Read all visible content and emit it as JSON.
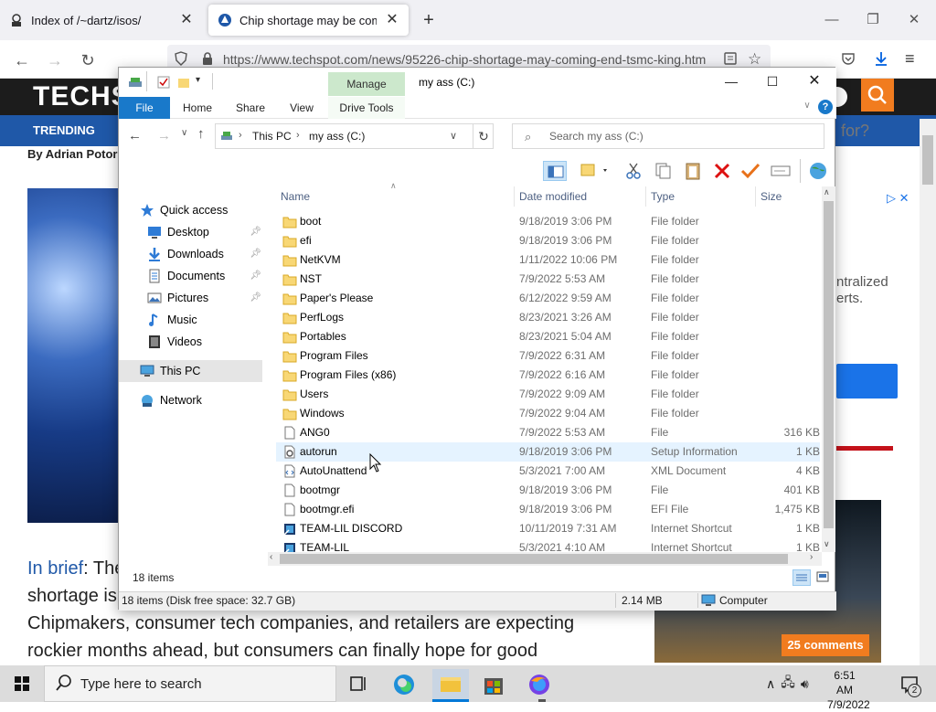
{
  "browser": {
    "tabs": [
      {
        "title": "Index of /~dartz/isos/",
        "active": false
      },
      {
        "title": "Chip shortage may be coming",
        "active": true
      }
    ],
    "url": "https://www.techspot.com/news/95226-chip-shortage-may-coming-end-tsmc-king.htm"
  },
  "site": {
    "logo": "TECHS",
    "nav_item": "TRENDING",
    "byline": "By Adrian Potoro",
    "search_hint": "for?",
    "ad_text_1": "ntralized",
    "ad_text_2": "erts.",
    "brief_label": "In brief",
    "brief_line1": ": The",
    "brief_line2": "shortage is",
    "brief_line3": "Chipmakers, consumer tech companies, and retailers are expecting",
    "brief_line4": "rockier months ahead, but consumers can finally hope for good",
    "comments_label": "25 comments"
  },
  "explorer": {
    "title": "my ass (C:)",
    "context_tab": "Manage",
    "ribbon_tabs": [
      "File",
      "Home",
      "Share",
      "View",
      "Drive Tools"
    ],
    "breadcrumb": [
      "This PC",
      "my ass (C:)"
    ],
    "search_placeholder": "Search my ass (C:)",
    "nav": {
      "quick_access": "Quick access",
      "items": [
        {
          "label": "Desktop",
          "pinned": true,
          "icon": "desktop-icon"
        },
        {
          "label": "Downloads",
          "pinned": true,
          "icon": "downloads-icon"
        },
        {
          "label": "Documents",
          "pinned": true,
          "icon": "documents-icon"
        },
        {
          "label": "Pictures",
          "pinned": true,
          "icon": "pictures-icon"
        },
        {
          "label": "Music",
          "pinned": false,
          "icon": "music-icon"
        },
        {
          "label": "Videos",
          "pinned": false,
          "icon": "videos-icon"
        }
      ],
      "this_pc": "This PC",
      "network": "Network"
    },
    "columns": [
      "Name",
      "Date modified",
      "Type",
      "Size"
    ],
    "files": [
      {
        "name": "boot",
        "date": "9/18/2019 3:06 PM",
        "type": "File folder",
        "size": "",
        "icon": "folder"
      },
      {
        "name": "efi",
        "date": "9/18/2019 3:06 PM",
        "type": "File folder",
        "size": "",
        "icon": "folder"
      },
      {
        "name": "NetKVM",
        "date": "1/11/2022 10:06 PM",
        "type": "File folder",
        "size": "",
        "icon": "folder"
      },
      {
        "name": "NST",
        "date": "7/9/2022 5:53 AM",
        "type": "File folder",
        "size": "",
        "icon": "folder"
      },
      {
        "name": "Paper's Please",
        "date": "6/12/2022 9:59 AM",
        "type": "File folder",
        "size": "",
        "icon": "folder"
      },
      {
        "name": "PerfLogs",
        "date": "8/23/2021 3:26 AM",
        "type": "File folder",
        "size": "",
        "icon": "folder"
      },
      {
        "name": "Portables",
        "date": "8/23/2021 5:04 AM",
        "type": "File folder",
        "size": "",
        "icon": "folder"
      },
      {
        "name": "Program Files",
        "date": "7/9/2022 6:31 AM",
        "type": "File folder",
        "size": "",
        "icon": "folder"
      },
      {
        "name": "Program Files (x86)",
        "date": "7/9/2022 6:16 AM",
        "type": "File folder",
        "size": "",
        "icon": "folder"
      },
      {
        "name": "Users",
        "date": "7/9/2022 9:09 AM",
        "type": "File folder",
        "size": "",
        "icon": "folder"
      },
      {
        "name": "Windows",
        "date": "7/9/2022 9:04 AM",
        "type": "File folder",
        "size": "",
        "icon": "folder"
      },
      {
        "name": "ANG0",
        "date": "7/9/2022 5:53 AM",
        "type": "File",
        "size": "316 KB",
        "icon": "file"
      },
      {
        "name": "autorun",
        "date": "9/18/2019 3:06 PM",
        "type": "Setup Information",
        "size": "1 KB",
        "icon": "setup"
      },
      {
        "name": "AutoUnattend",
        "date": "5/3/2021 7:00 AM",
        "type": "XML Document",
        "size": "4 KB",
        "icon": "xml"
      },
      {
        "name": "bootmgr",
        "date": "9/18/2019 3:06 PM",
        "type": "File",
        "size": "401 KB",
        "icon": "file"
      },
      {
        "name": "bootmgr.efi",
        "date": "9/18/2019 3:06 PM",
        "type": "EFI File",
        "size": "1,475 KB",
        "icon": "file"
      },
      {
        "name": "TEAM-LIL DISCORD",
        "date": "10/11/2019 7:31 AM",
        "type": "Internet Shortcut",
        "size": "1 KB",
        "icon": "shortcut"
      },
      {
        "name": "TEAM-LIL",
        "date": "5/3/2021 4:10 AM",
        "type": "Internet Shortcut",
        "size": "1 KB",
        "icon": "shortcut"
      }
    ],
    "item_count": "18 items",
    "status_left": "18 items (Disk free space: 32.7 GB)",
    "status_size": "2.14 MB",
    "status_computer": "Computer"
  },
  "taskbar": {
    "search_placeholder": "Type here to search",
    "time": "6:51 AM",
    "date": "7/9/2022",
    "notification_count": "2"
  },
  "colors": {
    "accent": "#1979ca",
    "manage_tab": "#cce8cc",
    "selection": "#e5e5e5",
    "hover_row": "#e5f3ff",
    "folder": "#f8d775"
  }
}
